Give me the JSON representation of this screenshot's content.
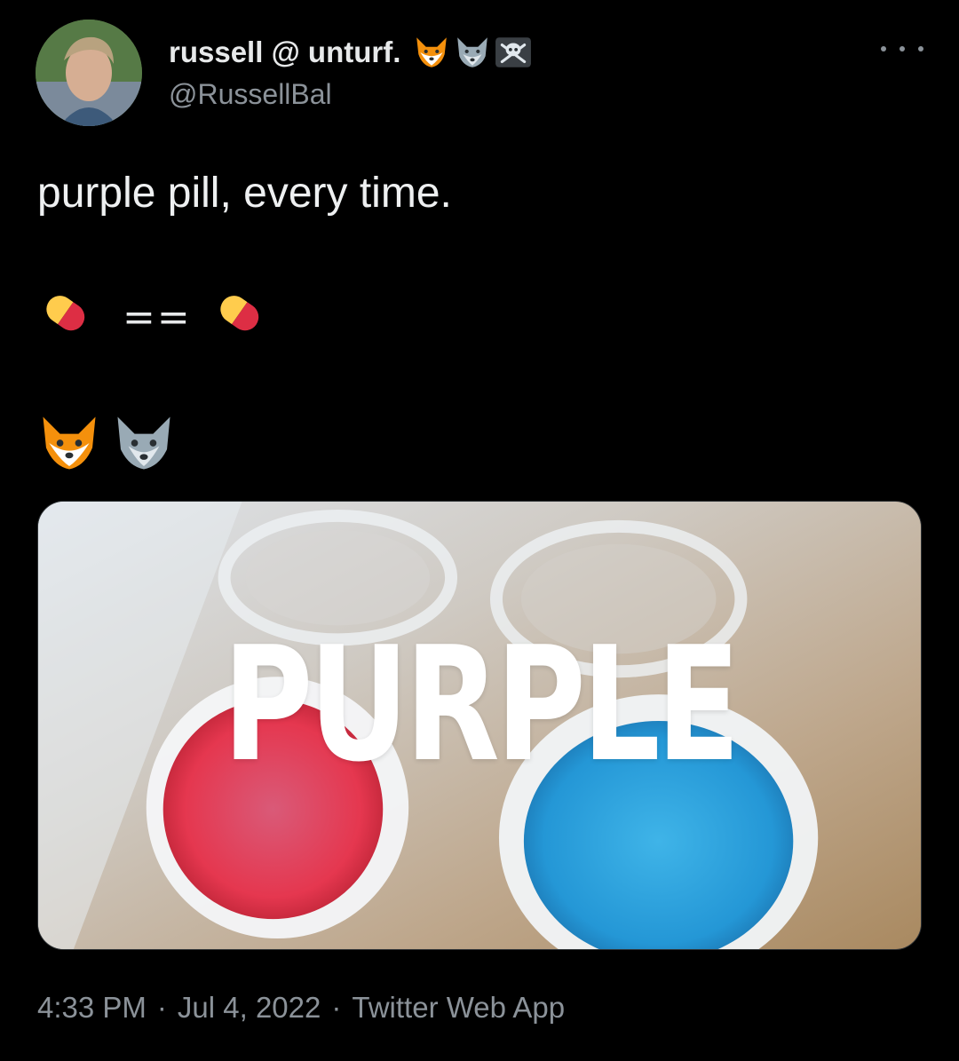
{
  "author": {
    "display_name": "russell @ unturf.",
    "name_emojis": [
      "fox-face",
      "wolf-face",
      "skull-and-crossbones"
    ],
    "handle": "@RussellBal"
  },
  "tweet": {
    "text": "purple pill, every time.",
    "pill_line": {
      "left_emoji": "pill",
      "operator": "==",
      "right_emoji": "pill"
    },
    "animal_line": [
      "fox-face",
      "wolf-face"
    ],
    "media": {
      "caption": "PURPLE"
    }
  },
  "meta": {
    "time": "4:33 PM",
    "separator": "·",
    "date": "Jul 4, 2022",
    "source": "Twitter Web App"
  },
  "colors": {
    "background": "#000000",
    "text": "#e7e9ea",
    "muted": "#8b9299",
    "pill_yellow": "#ffcc4d",
    "pill_red": "#dd2e44",
    "red_jello": "#e83a55",
    "blue_jello": "#2aa8e0"
  }
}
